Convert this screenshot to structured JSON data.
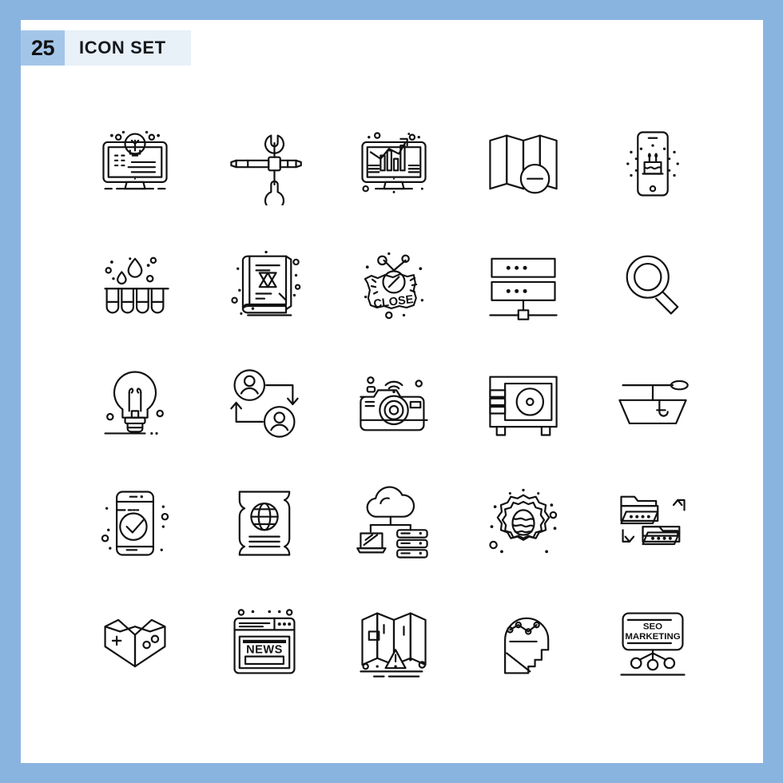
{
  "page": {
    "frame_color": "#8ab4e0",
    "canvas_color": "#ffffff"
  },
  "header": {
    "count": "25",
    "title": "ICON SET",
    "count_bg": "#a3c6e8",
    "title_bg": "#e8f0f8"
  },
  "grid": {
    "columns": 5,
    "rows": 5,
    "total": 25
  },
  "icons": [
    {
      "index": 1,
      "name": "monitor-lightbulb-icon",
      "label": "Creative Idea Monitor"
    },
    {
      "index": 2,
      "name": "wrench-screwdriver-icon",
      "label": "Tools Repair"
    },
    {
      "index": 3,
      "name": "monitor-growth-chart-icon",
      "label": "Analytics Monitor"
    },
    {
      "index": 4,
      "name": "map-minus-icon",
      "label": "Map Remove"
    },
    {
      "index": 5,
      "name": "mobile-birthday-cake-icon",
      "label": "Mobile Birthday"
    },
    {
      "index": 6,
      "name": "test-tubes-drops-icon",
      "label": "Test Tubes Sample"
    },
    {
      "index": 7,
      "name": "torah-book-star-icon",
      "label": "Holy Book Star Of David"
    },
    {
      "index": 8,
      "name": "close-sign-icon",
      "label": "Close Sign",
      "text": "CLOSE"
    },
    {
      "index": 9,
      "name": "server-network-icon",
      "label": "Server Network"
    },
    {
      "index": 10,
      "name": "magnifier-search-icon",
      "label": "Search Magnifier"
    },
    {
      "index": 11,
      "name": "lightbulb-idea-icon",
      "label": "Light Bulb Idea"
    },
    {
      "index": 12,
      "name": "user-exchange-icon",
      "label": "User Transfer"
    },
    {
      "index": 13,
      "name": "wifi-camera-icon",
      "label": "Wireless Camera"
    },
    {
      "index": 14,
      "name": "safe-vault-icon",
      "label": "Security Safe"
    },
    {
      "index": 15,
      "name": "fishing-boat-icon",
      "label": "Fishing Boat"
    },
    {
      "index": 16,
      "name": "mobile-checkmark-icon",
      "label": "Mobile Approved"
    },
    {
      "index": 17,
      "name": "globe-ticket-icon",
      "label": "Travel Ticket"
    },
    {
      "index": 18,
      "name": "cloud-computing-icon",
      "label": "Cloud Network"
    },
    {
      "index": 19,
      "name": "easter-egg-badge-icon",
      "label": "Easter Egg Badge"
    },
    {
      "index": 20,
      "name": "folder-transfer-icon",
      "label": "Folder Sync"
    },
    {
      "index": 21,
      "name": "gamepad-heart-icon",
      "label": "Game Controller"
    },
    {
      "index": 22,
      "name": "news-browser-icon",
      "label": "News Website",
      "text": "NEWS"
    },
    {
      "index": 23,
      "name": "map-warning-icon",
      "label": "Map Alert"
    },
    {
      "index": 24,
      "name": "head-analytics-icon",
      "label": "Analytical Mind"
    },
    {
      "index": 25,
      "name": "seo-marketing-card-icon",
      "label": "SEO Marketing",
      "text_line1": "SEO",
      "text_line2": "MARKETING"
    }
  ]
}
